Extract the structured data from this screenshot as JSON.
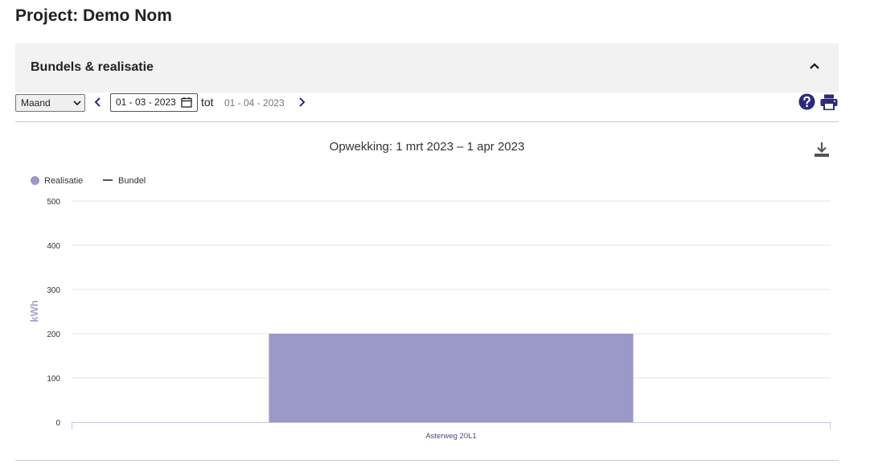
{
  "project": {
    "title": "Project: Demo Nom"
  },
  "panel": {
    "title": "Bundels & realisatie",
    "collapse_icon": "chevron-up-icon"
  },
  "toolbar": {
    "period_select": {
      "value": "Maand"
    },
    "date_from": "01 - 03 - 2023",
    "tot_label": "tot",
    "date_to": "01 - 04 - 2023",
    "prev_icon": "chevron-left-icon",
    "next_icon": "chevron-right-icon",
    "help_icon": "help-circle-icon",
    "print_icon": "printer-icon",
    "icon_color": "#2d2b7a"
  },
  "chart": {
    "download_icon": "download-icon"
  },
  "colors": {
    "bar": "#9a99c8",
    "ylabel": "#a7a6cf",
    "grid": "#e6e6e6",
    "axis_text": "#333333",
    "bundel_line": "#555555"
  },
  "chart_data": {
    "type": "bar",
    "title": "Opwekking: 1 mrt 2023 – 1 apr 2023",
    "categories": [
      "Asterweg 20L1"
    ],
    "series": [
      {
        "name": "Realisatie",
        "values": [
          200
        ]
      },
      {
        "name": "Bundel",
        "values": []
      }
    ],
    "xlabel": "",
    "ylabel": "kWh",
    "ylim": [
      0,
      500
    ],
    "yticks": [
      0,
      100,
      200,
      300,
      400,
      500
    ],
    "grid": true,
    "legend_position": "top-left"
  }
}
